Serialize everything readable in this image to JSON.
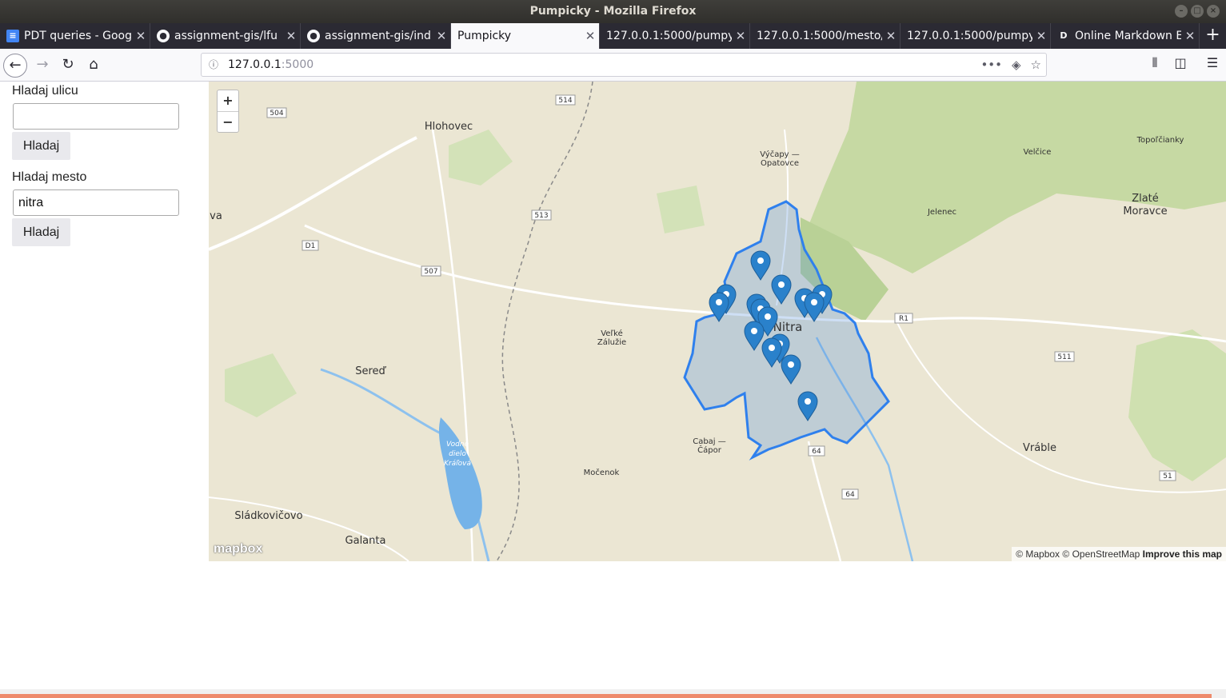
{
  "window": {
    "title": "Pumpicky - Mozilla Firefox"
  },
  "tabs": [
    {
      "label": "PDT queries - Goog",
      "icon": "google-docs-icon"
    },
    {
      "label": "assignment-gis/lfu",
      "icon": "github-icon"
    },
    {
      "label": "assignment-gis/ind",
      "icon": "github-icon"
    },
    {
      "label": "Pumpicky",
      "icon": "",
      "active": true
    },
    {
      "label": "127.0.0.1:5000/pumpy",
      "icon": ""
    },
    {
      "label": "127.0.0.1:5000/mesto/",
      "icon": ""
    },
    {
      "label": "127.0.0.1:5000/pumpy",
      "icon": ""
    },
    {
      "label": "Online Markdown E",
      "icon": "dillinger-icon"
    }
  ],
  "urlbar": {
    "host": "127.0.0.1",
    "port": ":5000"
  },
  "sidebar": {
    "street_label": "Hladaj ulicu",
    "street_value": "",
    "street_button": "Hladaj",
    "city_label": "Hladaj mesto",
    "city_value": "nitra",
    "city_button": "Hladaj"
  },
  "map": {
    "zoom_in": "+",
    "zoom_out": "−",
    "logo": "mapbox",
    "attribution_1": "© Mapbox",
    "attribution_2": "© OpenStreetMap",
    "attribution_3": "Improve this map",
    "colors": {
      "land": "#ebe6d3",
      "forest": "#c3d8a0",
      "water": "#75b3e8",
      "boundary": "#2f80ed",
      "marker": "#2a81cb"
    },
    "places": {
      "hlohovec": "Hlohovec",
      "vycapy": "Výčapy —",
      "opatovce": "Opatovce",
      "velcice": "Velčice",
      "topolcianky": "Topoľčianky",
      "zlate": "Zlaté",
      "moravce": "Moravce",
      "jelenec": "Jelenec",
      "va": "va",
      "nitra": "Nitra",
      "velke": "Veľké",
      "zaluzie": "Zálužie",
      "sered": "Sereď",
      "vodne": "Vodné",
      "dielo": "dielo",
      "kralova": "Kráľová",
      "cabaj": "Cabaj —",
      "capor": "Čápor",
      "mocenok": "Močenok",
      "vrable": "Vráble",
      "sladkovicovo": "Sládkovičovo",
      "galanta": "Galanta"
    },
    "roads": {
      "r504": "504",
      "r514": "514",
      "r513": "513",
      "rD1": "D1",
      "r507": "507",
      "rR1": "R1",
      "r511": "511",
      "r64a": "64",
      "r64b": "64",
      "r51": "51"
    }
  }
}
